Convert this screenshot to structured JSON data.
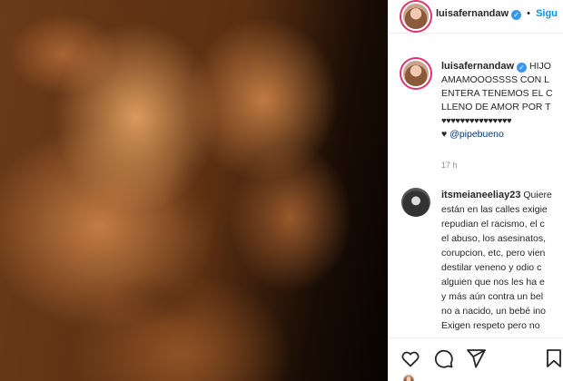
{
  "post_header": {
    "username": "luisafernandaw",
    "separator": "•",
    "follow_label": "Sigu"
  },
  "caption": {
    "username": "luisafernandaw",
    "lines": [
      "HIJO",
      "AMAMOOOSSSS CON L",
      "ENTERA TENEMOS EL C",
      "LLENO DE AMOR POR T",
      "♥♥♥♥♥♥♥♥♥♥♥♥♥♥♥"
    ],
    "heart": "♥",
    "mention": "@pipebueno",
    "time": "17 h"
  },
  "comment": {
    "username": "itsmeianeeliay23",
    "first_text": "Quiere",
    "lines": [
      "están en las calles exigie",
      "repudian el racismo, el c",
      "el abuso, los asesinatos,",
      "corupcion, etc, pero vien",
      "destilar veneno y odio c",
      "alguien que nos les ha e",
      "y más aún contra un bel",
      "no a nacido, un bebé ino",
      "Exigen respeto pero no"
    ]
  },
  "icons": {
    "like": "heart-outline-icon",
    "comment": "comment-bubble-icon",
    "share": "paper-plane-icon",
    "save": "bookmark-icon"
  },
  "colors": {
    "link": "#0095f6",
    "mention": "#00376b",
    "verified": "#3897f0",
    "muted": "#8e8e8e"
  }
}
